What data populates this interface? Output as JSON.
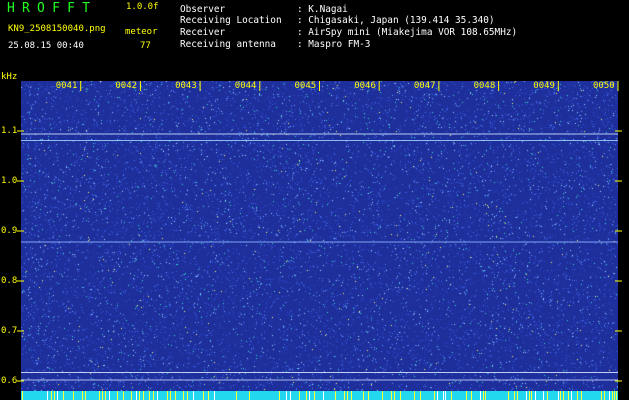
{
  "header": {
    "app_title": "HROFFT",
    "version": "1.0.0f",
    "filename": "KN9_2508150040.png",
    "meteor_label": "meteor",
    "timestamp": "25.08.15 00:40",
    "meteor_count": "77"
  },
  "info": [
    {
      "key": "Observer",
      "value": ": K.Nagai"
    },
    {
      "key": "Receiving Location",
      "value": ": Chigasaki, Japan (139.414 35.340)"
    },
    {
      "key": "Receiver",
      "value": ": AirSpy mini (Miakejima VOR 108.65MHz)"
    },
    {
      "key": "Receiving antenna",
      "value": ": Maspro FM-3"
    }
  ],
  "chart_data": {
    "type": "heatmap",
    "ylabel": "kHz",
    "y_tick_labels": [
      "1.1",
      "1.0",
      "0.9",
      "0.8",
      "0.7",
      "0.6"
    ],
    "y_ticks": [
      1.1,
      1.0,
      0.9,
      0.8,
      0.7,
      0.6
    ],
    "ylim": [
      0.58,
      1.2
    ],
    "x_tick_labels": [
      "0041",
      "0042",
      "0043",
      "0044",
      "0045",
      "0046",
      "0047",
      "0048",
      "0049",
      "0050"
    ],
    "x_ticks": [
      "00:41",
      "00:42",
      "00:43",
      "00:44",
      "00:45",
      "00:46",
      "00:47",
      "00:48",
      "00:49",
      "00:50"
    ],
    "xlim": [
      "00:40",
      "00:50"
    ],
    "horizontal_lines_kHz": [
      {
        "freq": 1.095,
        "color": "#cfe8ff"
      },
      {
        "freq": 1.082,
        "color": "#9fd8ff"
      },
      {
        "freq": 0.879,
        "color": "#8fb8ff"
      },
      {
        "freq": 0.618,
        "color": "#e0e8ff"
      },
      {
        "freq": 0.603,
        "color": "#c8d0ff"
      }
    ],
    "colors": {
      "background": "#1e2f9c",
      "speckle_light": "#9fd8ff",
      "speckle_cyan": "#35e0d0",
      "speckle_yellow": "#ffff66",
      "bottom_strip": "#22d8ee"
    }
  }
}
